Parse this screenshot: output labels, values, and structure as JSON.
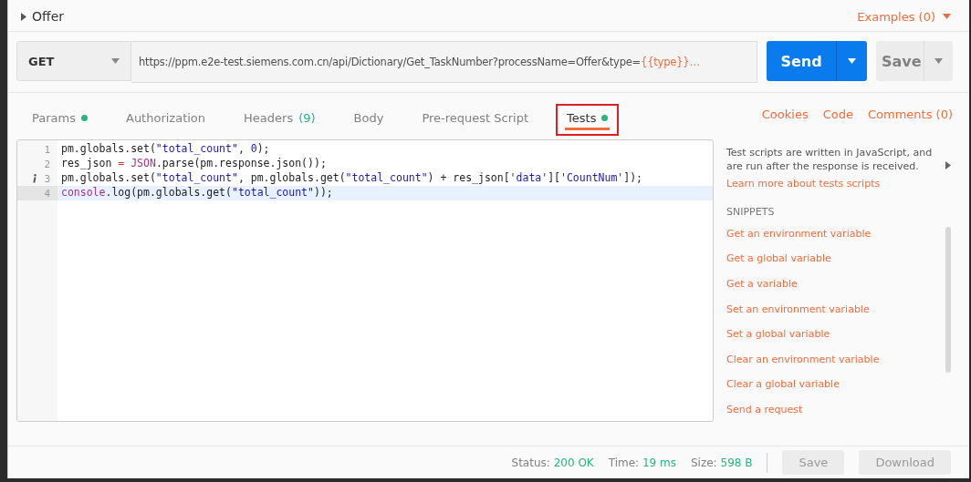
{
  "request": {
    "name": "Offer",
    "examples": "Examples (0)",
    "method": "GET",
    "url": "https://ppm.e2e-test.siemens.com.cn/api/Dictionary/Get_TaskNumber?processName=Offer&type=",
    "url_variable": "{{type}}…",
    "send": "Send",
    "save": "Save"
  },
  "tabs": [
    {
      "label": "Params",
      "dot": true,
      "selected": false
    },
    {
      "label": "Authorization",
      "dot": false,
      "selected": false
    },
    {
      "label": "Headers",
      "count": "(9)",
      "dot": false,
      "selected": false
    },
    {
      "label": "Body",
      "dot": false,
      "selected": false
    },
    {
      "label": "Pre-request Script",
      "dot": false,
      "selected": false
    },
    {
      "label": "Tests",
      "dot": true,
      "selected": true
    }
  ],
  "links": [
    "Cookies",
    "Code",
    "Comments (0)"
  ],
  "editor": {
    "lines": [
      {
        "number": "1",
        "info": false,
        "active": false,
        "tokens": [
          {
            "kind": "plain",
            "text": "pm.globals.set("
          },
          {
            "kind": "string",
            "text": "\"total_count\""
          },
          {
            "kind": "plain",
            "text": ", "
          },
          {
            "kind": "number",
            "text": "0"
          },
          {
            "kind": "plain",
            "text": ");"
          }
        ]
      },
      {
        "number": "2",
        "info": false,
        "active": false,
        "tokens": [
          {
            "kind": "plain",
            "text": "res_json "
          },
          {
            "kind": "operator",
            "text": "= "
          },
          {
            "kind": "keyword",
            "text": "JSON"
          },
          {
            "kind": "plain",
            "text": ".parse(pm.response.json());"
          }
        ]
      },
      {
        "number": "3",
        "info": true,
        "active": false,
        "tokens": [
          {
            "kind": "plain",
            "text": "pm.globals.set("
          },
          {
            "kind": "string",
            "text": "\"total_count\""
          },
          {
            "kind": "plain",
            "text": ", pm.globals.get("
          },
          {
            "kind": "string",
            "text": "\"total_count\""
          },
          {
            "kind": "plain",
            "text": ") + res_json["
          },
          {
            "kind": "string",
            "text": "'data'"
          },
          {
            "kind": "plain",
            "text": "]["
          },
          {
            "kind": "string",
            "text": "'CountNum'"
          },
          {
            "kind": "plain",
            "text": "]);"
          }
        ]
      },
      {
        "number": "4",
        "info": false,
        "active": true,
        "tokens": [
          {
            "kind": "keyword",
            "text": "console"
          },
          {
            "kind": "plain",
            "text": ".log(pm.globals.get("
          },
          {
            "kind": "string",
            "text": "\"total_count\""
          },
          {
            "kind": "plain",
            "text": "));"
          }
        ]
      }
    ]
  },
  "help": {
    "description": "Test scripts are written in JavaScript, and are run after the response is received.",
    "learn_more": "Learn more about tests scripts",
    "snippets_title": "SNIPPETS",
    "snippets": [
      "Get an environment variable",
      "Get a global variable",
      "Get a variable",
      "Set an environment variable",
      "Set a global variable",
      "Clear an environment variable",
      "Clear a global variable",
      "Send a request"
    ]
  },
  "response": {
    "status_label": "Status:",
    "status": "200 OK",
    "time_label": "Time:",
    "time": "19 ms",
    "size_label": "Size:",
    "size": "598 B",
    "save": "Save",
    "download": "Download"
  }
}
